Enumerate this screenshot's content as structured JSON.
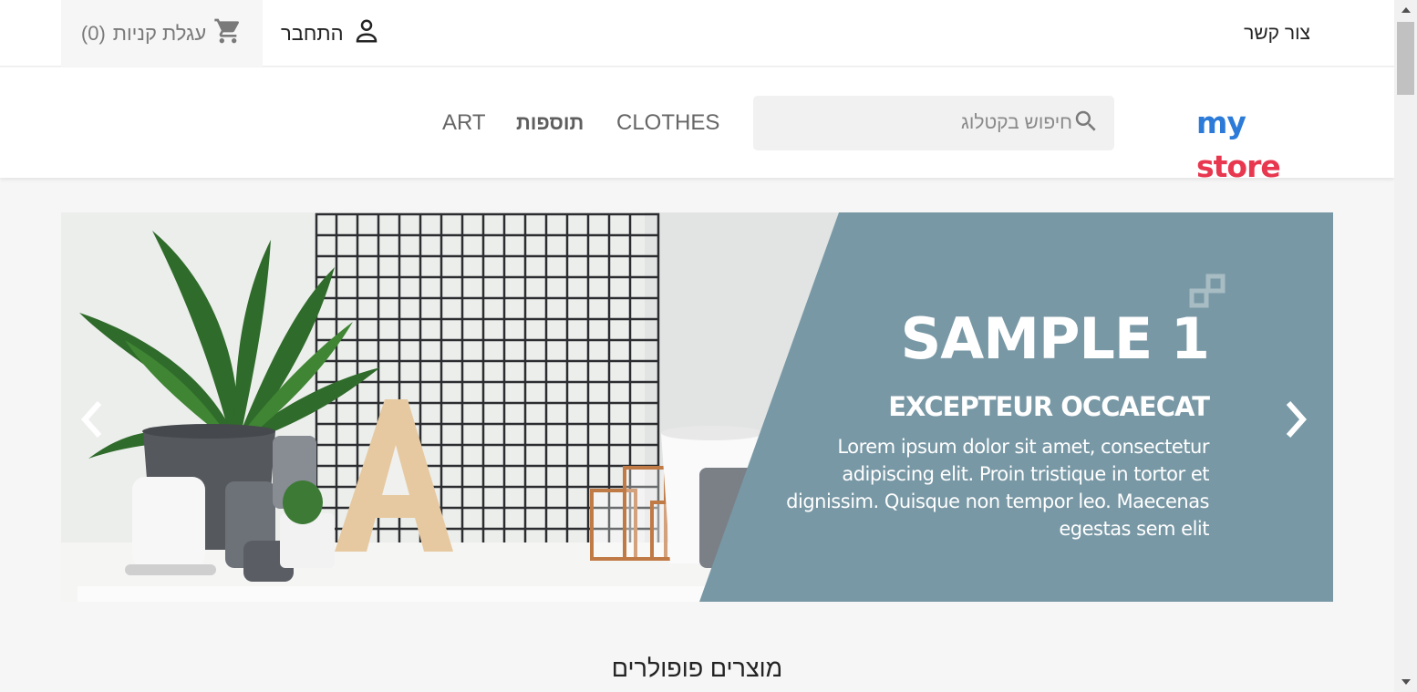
{
  "topbar": {
    "cart_label": "עגלת קניות",
    "cart_count": "(0)",
    "signin_label": "התחבר",
    "contact_label": "צור קשר"
  },
  "header": {
    "logo_part1": "my",
    "logo_part2": "store",
    "search_placeholder": "חיפוש בקטלוג",
    "nav": {
      "clothes": "CLOTHES",
      "accessories": "תוספות",
      "art": "ART"
    }
  },
  "carousel": {
    "title": "SAMPLE 1",
    "subtitle": "EXCEPTEUR OCCAECAT",
    "text": "Lorem ipsum dolor sit amet, consectetur adipiscing elit. Proin tristique in tortor et dignissim. Quisque non tempor leo. Maecenas egestas sem elit",
    "panel_color": "#7898a5"
  },
  "popular_title": "מוצרים פופולרים",
  "colors": {
    "accent_blue": "#2fb5d2",
    "logo_blue": "#2c7bd8",
    "logo_red": "#e8384f"
  }
}
